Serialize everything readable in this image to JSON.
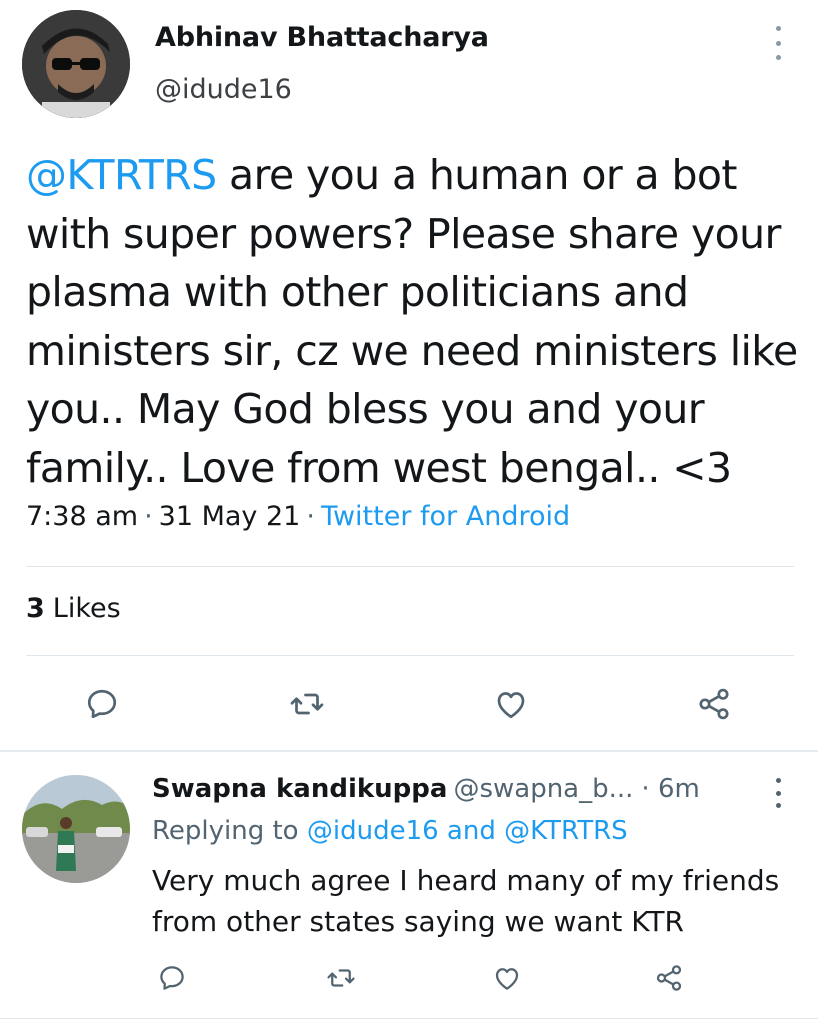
{
  "tweet": {
    "author_name": "Abhinav Bhattacharya",
    "author_handle": "@idude16",
    "text_mention": "@KTRTRS",
    "text_body": " are you a human or a bot with super powers? Please share your plasma with other politicians and ministers sir, cz we need ministers like you.. May God bless you and your family.. Love from west bengal.. <3",
    "time": "7:38 am",
    "date": "31 May 21",
    "source": "Twitter for Android",
    "separator": "·",
    "likes_count": "3",
    "likes_label": "Likes",
    "icons": {
      "reply": "reply-icon",
      "retweet": "retweet-icon",
      "like": "heart-icon",
      "share": "share-icon",
      "more": "more-vertical-icon"
    }
  },
  "reply": {
    "author_name": "Swapna kandikuppa",
    "author_handle": "@swapna_b...",
    "time": "· 6m",
    "replying_prefix": "Replying to",
    "replying_user1": "@idude16",
    "replying_and": "and",
    "replying_user2": "@KTRTRS",
    "text": "Very much agree I heard many of my friends from other states saying we want KTR"
  },
  "colors": {
    "link": "#1d9bf0",
    "text": "#14171a",
    "secondary": "#536471",
    "divider": "#e1e8ed",
    "icon": "#536471"
  }
}
